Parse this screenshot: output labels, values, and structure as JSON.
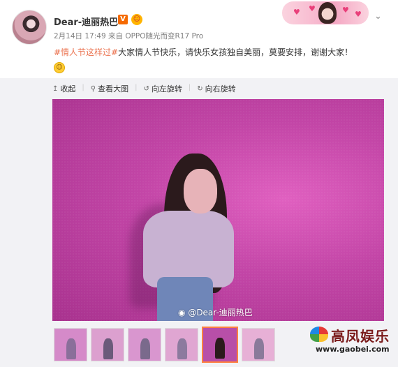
{
  "post": {
    "username": "Dear-迪丽热巴",
    "verified_badge": "V",
    "meta": "2月14日 17:49 来自 OPPO随光而变R17 Pro",
    "hashtag": "#情人节这样过#",
    "text": "大家情人节快乐，请快乐女孩独自美丽，莫要安排，谢谢大家！",
    "dropdown_icon": "chevron-down-icon"
  },
  "toolbar": {
    "collapse": "收起",
    "view_large": "查看大图",
    "rotate_left": "向左旋转",
    "rotate_right": "向右旋转"
  },
  "photo": {
    "watermark": "@Dear-迪丽热巴",
    "colors": {
      "wall": "#c245a6",
      "accent": "#ff8140"
    }
  },
  "thumbnails": [
    {
      "bg": "#d58ac9",
      "person": "#8a6f9a",
      "selected": false
    },
    {
      "bg": "#dca0cf",
      "person": "#6b5a7a",
      "selected": false
    },
    {
      "bg": "#d996cf",
      "person": "#7a6a8c",
      "selected": false
    },
    {
      "bg": "#e0a6d2",
      "person": "#8c7a9e",
      "selected": false
    },
    {
      "bg": "#b84fa8",
      "person": "#2b1a1c",
      "selected": true
    },
    {
      "bg": "#e7b0d6",
      "person": "#8a7a9a",
      "selected": false
    }
  ],
  "logo": {
    "name": "高凤娱乐",
    "url": "www.gaobei.com"
  }
}
